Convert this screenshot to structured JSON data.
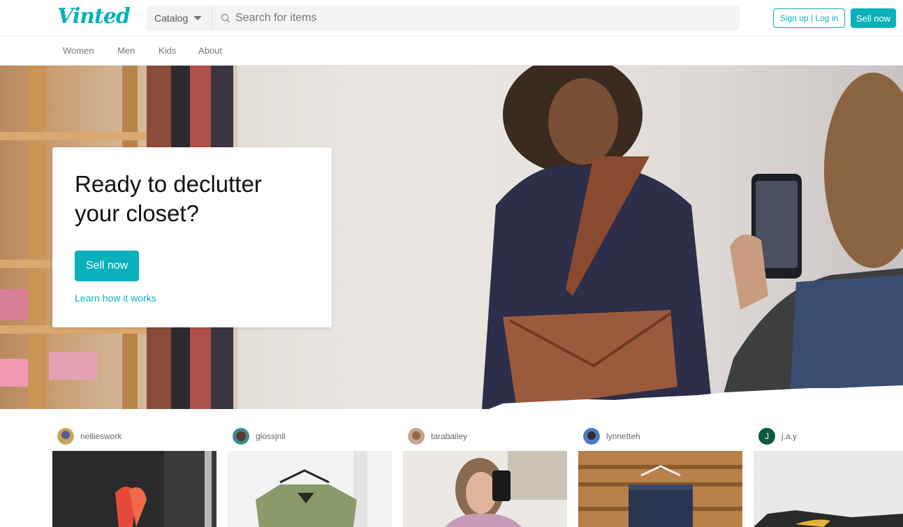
{
  "brand": {
    "logo_text": "Vinted",
    "accent_color": "#09b1ba"
  },
  "header": {
    "catalog_label": "Catalog",
    "search_placeholder": "Search for items",
    "signup_label": "Sign up | Log in",
    "sell_label": "Sell now"
  },
  "nav": {
    "items": [
      {
        "label": "Women"
      },
      {
        "label": "Men"
      },
      {
        "label": "Kids"
      },
      {
        "label": "About"
      }
    ]
  },
  "hero": {
    "title": "Ready to declutter your closet?",
    "sell_button": "Sell now",
    "learn_link": "Learn how it works"
  },
  "feed": {
    "items": [
      {
        "username": "nellieswork",
        "avatar_icon": "user-photo-avatar"
      },
      {
        "username": "glossjnll",
        "avatar_icon": "user-photo-avatar"
      },
      {
        "username": "tarabailey",
        "avatar_icon": "user-photo-avatar"
      },
      {
        "username": "lynnetteh",
        "avatar_icon": "user-photo-avatar"
      },
      {
        "username": "j.a.y",
        "avatar_initial": "J",
        "avatar_color": "#0b5a3c"
      }
    ]
  }
}
